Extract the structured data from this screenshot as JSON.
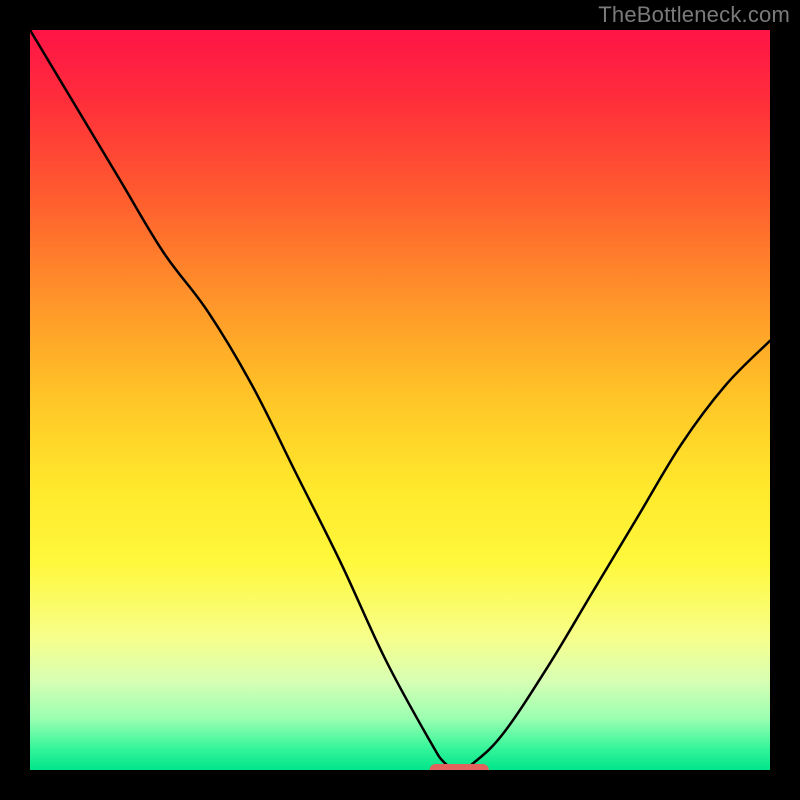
{
  "watermark": "TheBottleneck.com",
  "accent_marker_color": "#e2625d",
  "gradient_stops": [
    {
      "offset": 0.0,
      "color": "#ff1447"
    },
    {
      "offset": 0.1,
      "color": "#ff2f3a"
    },
    {
      "offset": 0.22,
      "color": "#ff5a2f"
    },
    {
      "offset": 0.35,
      "color": "#ff8f2a"
    },
    {
      "offset": 0.5,
      "color": "#ffc627"
    },
    {
      "offset": 0.62,
      "color": "#ffe92c"
    },
    {
      "offset": 0.72,
      "color": "#fff83c"
    },
    {
      "offset": 0.82,
      "color": "#f7ff8a"
    },
    {
      "offset": 0.88,
      "color": "#d7ffb4"
    },
    {
      "offset": 0.93,
      "color": "#9bffb1"
    },
    {
      "offset": 0.97,
      "color": "#37f59b"
    },
    {
      "offset": 1.0,
      "color": "#00e58a"
    }
  ],
  "chart_data": {
    "type": "line",
    "title": "",
    "xlabel": "",
    "ylabel": "",
    "xlim": [
      0,
      100
    ],
    "ylim": [
      0,
      100
    ],
    "x": [
      0,
      6,
      12,
      18,
      24,
      30,
      36,
      42,
      48,
      54,
      56,
      58,
      60,
      64,
      70,
      76,
      82,
      88,
      94,
      100
    ],
    "values": [
      100,
      90,
      80,
      70,
      62,
      52,
      40,
      28,
      15,
      4,
      1,
      0,
      1,
      5,
      14,
      24,
      34,
      44,
      52,
      58
    ],
    "optimum_x": 58,
    "marker": {
      "x_start": 54,
      "x_end": 62,
      "y": 0
    }
  }
}
